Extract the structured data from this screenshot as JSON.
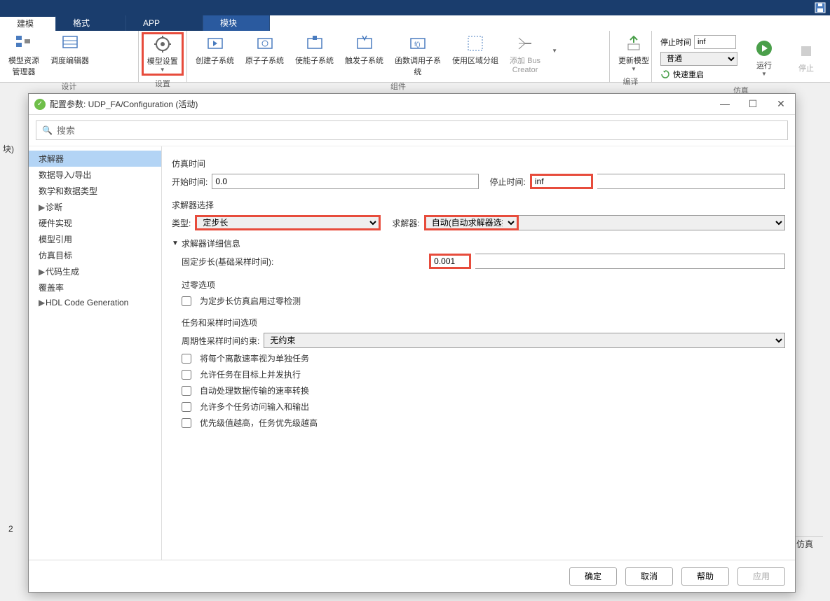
{
  "tabs": {
    "t1": "建模",
    "t2": "格式",
    "t3": "APP",
    "t4": "模块"
  },
  "ribbon": {
    "design_group": "设计",
    "settings_group": "设置",
    "components_group": "组件",
    "compile_group": "编译",
    "sim_group": "仿真",
    "model_res_mgr": "模型资源\n管理器",
    "model_res_mgr_l1": "模型资源",
    "model_res_mgr_l2": "管理器",
    "sched_editor": "调度编辑器",
    "model_settings": "模型设置",
    "create_sub": "创建子系统",
    "atomic_sub": "原子子系统",
    "enable_sub": "使能子系统",
    "trigger_sub": "触发子系统",
    "func_call_l1": "函数调用子系",
    "func_call_l2": "统",
    "region_group": "使用区域分组",
    "add_bus_l1": "添加 Bus",
    "add_bus_l2": "Creator",
    "update_model": "更新模型",
    "stop_time_label": "停止时间",
    "stop_time_value": "inf",
    "mode_value": "普通",
    "fast_restart": "快速重启",
    "run": "运行",
    "stop": "停止"
  },
  "side": {
    "label": "块)",
    "count": "2",
    "sim": "仿真"
  },
  "dialog": {
    "title": "配置参数: UDP_FA/Configuration (活动)",
    "search_placeholder": "搜索",
    "tree": {
      "solver": "求解器",
      "data_io": "数据导入/导出",
      "math_types": "数学和数据类型",
      "diagnostics": "诊断",
      "hw_impl": "硬件实现",
      "model_ref": "模型引用",
      "sim_target": "仿真目标",
      "code_gen": "代码生成",
      "coverage": "覆盖率",
      "hdl": "HDL Code Generation"
    },
    "content": {
      "sim_time": "仿真时间",
      "start_time_label": "开始时间:",
      "start_time_value": "0.0",
      "stop_time_label": "停止时间:",
      "stop_time_value": "inf",
      "solver_sel": "求解器选择",
      "type_label": "类型:",
      "type_value": "定步长",
      "solver_label": "求解器:",
      "solver_value": "自动(自动求解器选择)",
      "details_title": "求解器详细信息",
      "fixed_step_label": "固定步长(基础采样时间):",
      "fixed_step_value": "0.001",
      "zero_cross_title": "过零选项",
      "zero_cross_cb": "为定步长仿真启用过零检测",
      "task_title": "任务和采样时间选项",
      "periodic_label": "周期性采样时间约束:",
      "periodic_value": "无约束",
      "cb1": "将每个离散速率视为单独任务",
      "cb2": "允许任务在目标上并发执行",
      "cb3": "自动处理数据传输的速率转换",
      "cb4": "允许多个任务访问输入和输出",
      "cb5": "优先级值越高，任务优先级越高"
    },
    "footer": {
      "ok": "确定",
      "cancel": "取消",
      "help": "帮助",
      "apply": "应用"
    }
  }
}
